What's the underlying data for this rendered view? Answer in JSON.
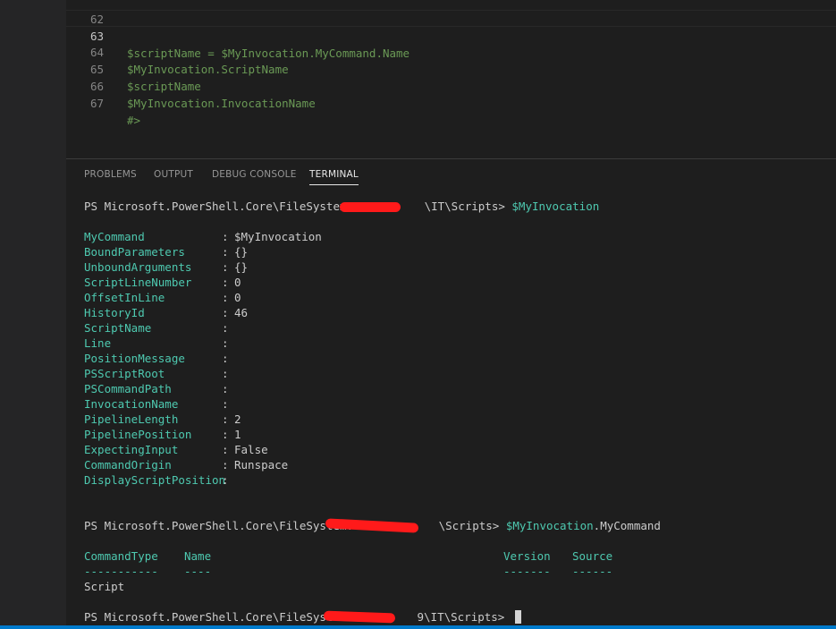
{
  "editor": {
    "lines": [
      {
        "num": "62",
        "code": ""
      },
      {
        "num": "63",
        "code": "$scriptName = $MyInvocation.MyCommand.Name"
      },
      {
        "num": "64",
        "code": "$MyInvocation.ScriptName"
      },
      {
        "num": "65",
        "code": "$scriptName"
      },
      {
        "num": "66",
        "code": "$MyInvocation.InvocationName"
      },
      {
        "num": "67",
        "code": "#>"
      }
    ]
  },
  "panel": {
    "tabs": [
      "PROBLEMS",
      "OUTPUT",
      "DEBUG CONSOLE",
      "TERMINAL"
    ],
    "active_tab": "TERMINAL"
  },
  "terminal": {
    "prompt1": {
      "prefix": "PS Microsoft.PowerShell.Core\\FileSystem::",
      "suffix": "\\IT\\Scripts> ",
      "command": "$MyInvocation"
    },
    "properties": [
      {
        "key": "MyCommand",
        "value": "$MyInvocation"
      },
      {
        "key": "BoundParameters",
        "value": "{}"
      },
      {
        "key": "UnboundArguments",
        "value": "{}"
      },
      {
        "key": "ScriptLineNumber",
        "value": "0"
      },
      {
        "key": "OffsetInLine",
        "value": "0"
      },
      {
        "key": "HistoryId",
        "value": "46"
      },
      {
        "key": "ScriptName",
        "value": ""
      },
      {
        "key": "Line",
        "value": ""
      },
      {
        "key": "PositionMessage",
        "value": ""
      },
      {
        "key": "PSScriptRoot",
        "value": ""
      },
      {
        "key": "PSCommandPath",
        "value": ""
      },
      {
        "key": "InvocationName",
        "value": ""
      },
      {
        "key": "PipelineLength",
        "value": "2"
      },
      {
        "key": "PipelinePosition",
        "value": "1"
      },
      {
        "key": "ExpectingInput",
        "value": "False"
      },
      {
        "key": "CommandOrigin",
        "value": "Runspace"
      },
      {
        "key": "DisplayScriptPosition",
        "value": ""
      }
    ],
    "prompt2": {
      "prefix": "PS Microsoft.PowerShell.Core\\FileSystem::",
      "suffix": "\\Scripts> ",
      "command_var": "$MyInvocation",
      "command_member": ".MyCommand"
    },
    "table": {
      "headers": [
        "CommandType",
        "Name",
        "Version",
        "Source"
      ],
      "underlines": [
        "-----------",
        "----",
        "-------",
        "------"
      ],
      "row": [
        "Script",
        "",
        "",
        ""
      ]
    },
    "prompt3": {
      "prefix": "PS Microsoft.PowerShell.Core\\FileSystem",
      "suffix": "9\\IT\\Scripts> "
    }
  },
  "colors": {
    "accent": "#007acc",
    "terminal_green": "#4ec9b0",
    "comment_green": "#6a9955",
    "redaction": "#ff1a1a"
  }
}
